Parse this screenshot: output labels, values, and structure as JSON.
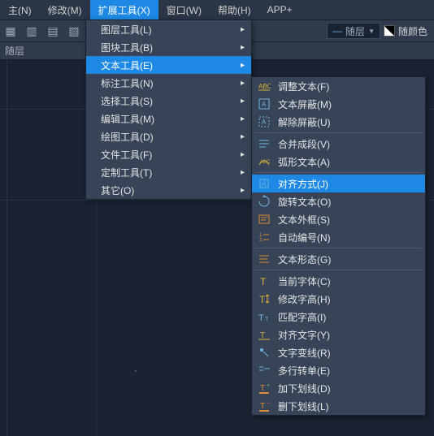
{
  "menubar": {
    "items": [
      {
        "label": "主(N)"
      },
      {
        "label": "修改(M)"
      },
      {
        "label": "扩展工具(X)",
        "active": true
      },
      {
        "label": "窗口(W)"
      },
      {
        "label": "帮助(H)"
      },
      {
        "label": "APP+"
      }
    ]
  },
  "toolbar_right": {
    "layer_label": "随层",
    "color_label": "随颜色"
  },
  "secondbar": {
    "label": "随层"
  },
  "menu1": {
    "items": [
      {
        "label": "图层工具(L)",
        "sub": true
      },
      {
        "label": "图块工具(B)",
        "sub": true
      },
      {
        "label": "文本工具(E)",
        "sub": true,
        "active": true
      },
      {
        "label": "标注工具(N)",
        "sub": true
      },
      {
        "label": "选择工具(S)",
        "sub": true
      },
      {
        "label": "编辑工具(M)",
        "sub": true
      },
      {
        "label": "绘图工具(D)",
        "sub": true
      },
      {
        "label": "文件工具(F)",
        "sub": true
      },
      {
        "label": "定制工具(T)",
        "sub": true
      },
      {
        "label": "其它(O)",
        "sub": true
      }
    ]
  },
  "menu2": {
    "groups": [
      [
        {
          "label": "调整文本(F)",
          "icon": "adjust-text",
          "cls": "ic-yellow"
        },
        {
          "label": "文本屏蔽(M)",
          "icon": "text-mask",
          "cls": "ic-blue"
        },
        {
          "label": "解除屏蔽(U)",
          "icon": "text-unmask",
          "cls": "ic-blue"
        }
      ],
      [
        {
          "label": "合并成段(V)",
          "icon": "merge-paragraph",
          "cls": "ic-blue"
        },
        {
          "label": "弧形文本(A)",
          "icon": "arc-text",
          "cls": "ic-yellow"
        }
      ],
      [
        {
          "label": "对齐方式(J)",
          "icon": "alignment",
          "cls": "ic-blue",
          "active": true
        },
        {
          "label": "旋转文本(O)",
          "icon": "rotate-text",
          "cls": "ic-blue"
        },
        {
          "label": "文本外框(S)",
          "icon": "text-frame",
          "cls": "ic-orange"
        },
        {
          "label": "自动编号(N)",
          "icon": "auto-number",
          "cls": "ic-orange"
        }
      ],
      [
        {
          "label": "文本形态(G)",
          "icon": "text-shape",
          "cls": "ic-orange"
        }
      ],
      [
        {
          "label": "当前字体(C)",
          "icon": "current-font",
          "cls": "ic-yellow"
        },
        {
          "label": "修改字高(H)",
          "icon": "change-height",
          "cls": "ic-yellow"
        },
        {
          "label": "匹配字高(I)",
          "icon": "match-height",
          "cls": "ic-blue"
        },
        {
          "label": "对齐文字(Y)",
          "icon": "align-text",
          "cls": "ic-yellow"
        },
        {
          "label": "文字变线(R)",
          "icon": "text-to-line",
          "cls": "ic-blue"
        },
        {
          "label": "多行转单(E)",
          "icon": "multi-to-single",
          "cls": "ic-blue"
        },
        {
          "label": "加下划线(D)",
          "icon": "underline-add",
          "cls": "ic-orange"
        },
        {
          "label": "删下划线(L)",
          "icon": "underline-del",
          "cls": "ic-orange"
        }
      ]
    ]
  }
}
